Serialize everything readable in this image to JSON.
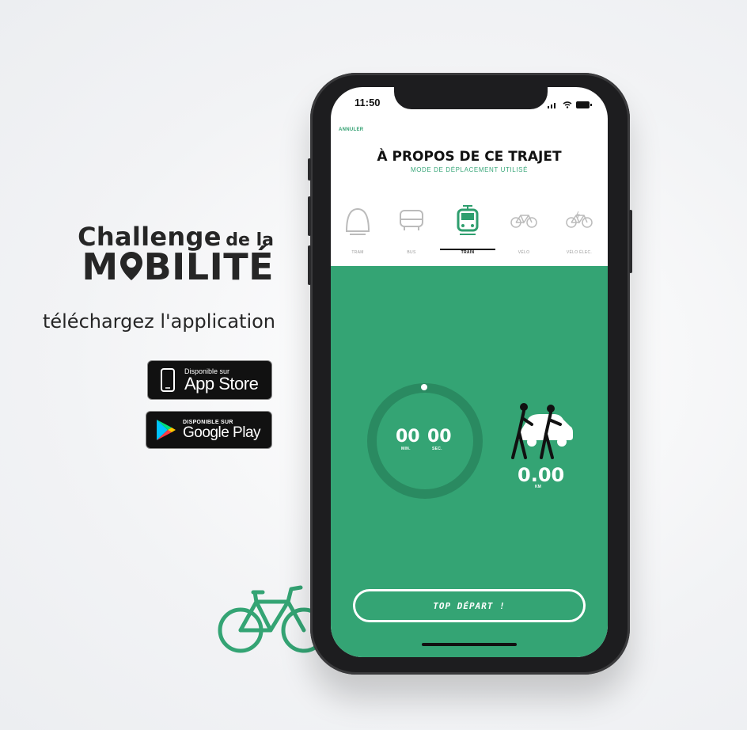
{
  "promo": {
    "brand_line1_big": "Challenge",
    "brand_line1_small": "de la",
    "brand_line2_pre": "M",
    "brand_line2_post": "BILITÉ",
    "download_text": "téléchargez l'application",
    "app_store": {
      "small": "Disponible sur",
      "big": "App Store"
    },
    "google_play": {
      "small": "DISPONIBLE SUR",
      "big": "Google Play"
    }
  },
  "phone": {
    "status_time": "11:50",
    "cancel_label": "ANNULER",
    "title": "À PROPOS DE CE TRAJET",
    "subtitle": "MODE DE DÉPLACEMENT UTILISÉ",
    "modes": [
      {
        "label": "TRAM",
        "icon": "tram-icon"
      },
      {
        "label": "BUS",
        "icon": "bus-icon"
      },
      {
        "label": "TRAIN",
        "icon": "train-icon",
        "active": true
      },
      {
        "label": "VÉLO",
        "icon": "bike-icon"
      },
      {
        "label": "VÉLO ÉLEC.",
        "icon": "ebike-icon"
      }
    ],
    "timer": {
      "minutes": "00",
      "seconds": "00",
      "min_label": "MIN.",
      "sec_label": "SEC."
    },
    "distance": {
      "value": "0.00",
      "unit": "KM"
    },
    "start_button": "TOP DÉPART !",
    "colors": {
      "accent": "#34a474",
      "accent_dark": "#2a8a61"
    }
  }
}
